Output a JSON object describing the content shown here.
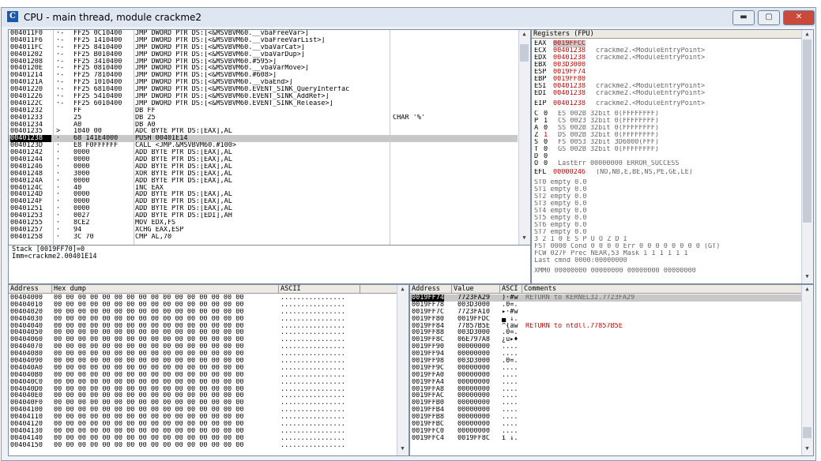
{
  "window": {
    "title": "CPU - main thread, module crackme2",
    "icon_letter": "C",
    "minimize": "▬",
    "maximize": "▢",
    "close": "✕"
  },
  "disasm": {
    "rows": [
      {
        "addr": "004011F0",
        "m": "·-",
        "hex": "FF25 0C10400",
        "asm": "JMP DWORD PTR DS:[<&MSVBVM60.__vbaFreeVar>]",
        "cmt": ""
      },
      {
        "addr": "004011F6",
        "m": "·-",
        "hex": "FF25 1410400",
        "asm": "JMP DWORD PTR DS:[<&MSVBVM60.__vbaFreeVarList>]",
        "cmt": ""
      },
      {
        "addr": "004011FC",
        "m": "·-",
        "hex": "FF25 8410400",
        "asm": "JMP DWORD PTR DS:[<&MSVBVM60.__vbaVarCat>]",
        "cmt": ""
      },
      {
        "addr": "00401202",
        "m": "·-",
        "hex": "FF25 B010400",
        "asm": "JMP DWORD PTR DS:[<&MSVBVM60.__vbaVarDup>]",
        "cmt": ""
      },
      {
        "addr": "00401208",
        "m": "·-",
        "hex": "FF25 3410400",
        "asm": "JMP DWORD PTR DS:[<&MSVBVM60.#595>]",
        "cmt": ""
      },
      {
        "addr": "0040120E",
        "m": "·-",
        "hex": "FF25 0810400",
        "asm": "JMP DWORD PTR DS:[<&MSVBVM60.__vbaVarMove>]",
        "cmt": ""
      },
      {
        "addr": "00401214",
        "m": "·-",
        "hex": "FF25 7810400",
        "asm": "JMP DWORD PTR DS:[<&MSVBVM60.#608>]",
        "cmt": ""
      },
      {
        "addr": "0040121A",
        "m": "·-",
        "hex": "FF25 1010400",
        "asm": "JMP DWORD PTR DS:[<&MSVBVM60.__vbaEnd>]",
        "cmt": ""
      },
      {
        "addr": "00401220",
        "m": "·-",
        "hex": "FF25 6810400",
        "asm": "JMP DWORD PTR DS:[<&MSVBVM60.EVENT_SINK_QueryInterfac",
        "cmt": ""
      },
      {
        "addr": "00401226",
        "m": "·-",
        "hex": "FF25 5410400",
        "asm": "JMP DWORD PTR DS:[<&MSVBVM60.EVENT_SINK_AddRef>]",
        "cmt": ""
      },
      {
        "addr": "0040122C",
        "m": "·-",
        "hex": "FF25 6010400",
        "asm": "JMP DWORD PTR DS:[<&MSVBVM60.EVENT_SINK_Release>]",
        "cmt": ""
      },
      {
        "addr": "00401232",
        "m": "",
        "hex": "FF",
        "asm": "DB FF",
        "cmt": ""
      },
      {
        "addr": "00401233",
        "m": "",
        "hex": "25",
        "asm": "DB 25",
        "cmt": "CHAR '%'"
      },
      {
        "addr": "00401234",
        "m": "",
        "hex": "A0",
        "asm": "DB A0",
        "cmt": ""
      },
      {
        "addr": "00401235",
        "m": ">",
        "hex": "1040 00",
        "asm": "ADC BYTE PTR DS:[EAX],AL",
        "cmt": ""
      },
      {
        "addr": "00401238",
        "m": "·",
        "hex": "68 141E4000",
        "asm": "PUSH 00401E14",
        "cmt": ""
      },
      {
        "addr": "0040123D",
        "m": "·",
        "hex": "E8 F0FFFFFF",
        "asm": "CALL <JMP.&MSVBVM60.#100>",
        "cmt": ""
      },
      {
        "addr": "00401242",
        "m": "·",
        "hex": "0000",
        "asm": "ADD BYTE PTR DS:[EAX],AL",
        "cmt": ""
      },
      {
        "addr": "00401244",
        "m": "·",
        "hex": "0000",
        "asm": "ADD BYTE PTR DS:[EAX],AL",
        "cmt": ""
      },
      {
        "addr": "00401246",
        "m": "·",
        "hex": "0000",
        "asm": "ADD BYTE PTR DS:[EAX],AL",
        "cmt": ""
      },
      {
        "addr": "00401248",
        "m": "·",
        "hex": "3000",
        "asm": "XOR BYTE PTR DS:[EAX],AL",
        "cmt": ""
      },
      {
        "addr": "0040124A",
        "m": "·",
        "hex": "0000",
        "asm": "ADD BYTE PTR DS:[EAX],AL",
        "cmt": ""
      },
      {
        "addr": "0040124C",
        "m": "·",
        "hex": "40",
        "asm": "INC EAX",
        "cmt": ""
      },
      {
        "addr": "0040124D",
        "m": "·",
        "hex": "0000",
        "asm": "ADD BYTE PTR DS:[EAX],AL",
        "cmt": ""
      },
      {
        "addr": "0040124F",
        "m": "·",
        "hex": "0000",
        "asm": "ADD BYTE PTR DS:[EAX],AL",
        "cmt": ""
      },
      {
        "addr": "00401251",
        "m": "·",
        "hex": "0000",
        "asm": "ADD BYTE PTR DS:[EAX],AL",
        "cmt": ""
      },
      {
        "addr": "00401253",
        "m": "·",
        "hex": "0027",
        "asm": "ADD BYTE PTR DS:[EDI],AH",
        "cmt": ""
      },
      {
        "addr": "00401255",
        "m": "·",
        "hex": "8CE2",
        "asm": "MOV EDX,FS",
        "cmt": ""
      },
      {
        "addr": "00401257",
        "m": "·",
        "hex": "94",
        "asm": "XCHG EAX,ESP",
        "cmt": ""
      },
      {
        "addr": "00401258",
        "m": "·",
        "hex": "3C 70",
        "asm": "CMP AL,70",
        "cmt": ""
      }
    ],
    "selected_index": 15
  },
  "info": {
    "line1": "Stack [0019FF70]=0",
    "line2": "Imm=crackme2.00401E14"
  },
  "registers": {
    "header": "Registers (FPU)",
    "gp": [
      {
        "name": "EAX",
        "val": "0019FFCC",
        "cmt": ""
      },
      {
        "name": "ECX",
        "val": "00401238",
        "cmt": "crackme2.<ModuleEntryPoint>"
      },
      {
        "name": "EDX",
        "val": "00401238",
        "cmt": "crackme2.<ModuleEntryPoint>"
      },
      {
        "name": "EBX",
        "val": "003D3000",
        "cmt": ""
      },
      {
        "name": "ESP",
        "val": "0019FF74",
        "cmt": ""
      },
      {
        "name": "EBP",
        "val": "0019FF80",
        "cmt": ""
      },
      {
        "name": "ESI",
        "val": "00401238",
        "cmt": "crackme2.<ModuleEntryPoint>"
      },
      {
        "name": "EDI",
        "val": "00401238",
        "cmt": "crackme2.<ModuleEntryPoint>"
      }
    ],
    "eip": {
      "name": "EIP",
      "val": "00401238",
      "cmt": "crackme2.<ModuleEntryPoint>"
    },
    "flags": [
      {
        "f": "C",
        "v": "0",
        "seg": "ES 002B 32bit 0(FFFFFFFF)"
      },
      {
        "f": "P",
        "v": "1",
        "seg": "CS 0023 32bit 0(FFFFFFFF)"
      },
      {
        "f": "A",
        "v": "0",
        "seg": "SS 002B 32bit 0(FFFFFFFF)"
      },
      {
        "f": "Z",
        "v": "1",
        "seg": "DS 002B 32bit 0(FFFFFFFF)"
      },
      {
        "f": "S",
        "v": "0",
        "seg": "FS 0053 32bit 3D6000(FFF)"
      },
      {
        "f": "T",
        "v": "0",
        "seg": "GS 002B 32bit 0(FFFFFFFF)"
      },
      {
        "f": "D",
        "v": "0",
        "seg": ""
      },
      {
        "f": "O",
        "v": "0",
        "seg": "LastErr 00000000 ERROR_SUCCESS"
      }
    ],
    "efl": {
      "label": "EFL",
      "val": "00000246",
      "cmt": "(NO,NB,E,BE,NS,PE,GE,LE)"
    },
    "st": [
      "ST0 empty 0.0",
      "ST1 empty 0.0",
      "ST2 empty 0.0",
      "ST3 empty 0.0",
      "ST4 empty 0.0",
      "ST5 empty 0.0",
      "ST6 empty 0.0",
      "ST7 empty 0.0"
    ],
    "fpu_bits": "               3 2 1 0      E S P U O Z D I",
    "fst": "FST 0000  Cond 0 0 0 0  Err 0 0 0 0 0 0 0 0  (GT)",
    "fcw": "FCW 027F  Prec NEAR,53  Mask    1 1 1 1 1 1",
    "last_cmnd": "Last cmnd 0000:00000000",
    "xmm0": "XMM0 00000000 00000000 00000000 00000000"
  },
  "dump": {
    "headers": {
      "address": "Address",
      "hex": "Hex dump",
      "ascii": "ASCII"
    },
    "hex_zero": "00 00 00 00 00 00 00 00 00 00 00 00 00 00 00 00",
    "ascii_zero": "................",
    "addresses": [
      "00404000",
      "00404010",
      "00404020",
      "00404030",
      "00404040",
      "00404050",
      "00404060",
      "00404070",
      "00404080",
      "00404090",
      "004040A0",
      "004040B0",
      "004040C0",
      "004040D0",
      "004040E0",
      "004040F0",
      "00404100",
      "00404110",
      "00404120",
      "00404130",
      "00404140",
      "00404150"
    ]
  },
  "stack": {
    "headers": {
      "address": "Address",
      "value": "Value",
      "ascii": "ASCI",
      "comments": "Comments"
    },
    "rows": [
      {
        "addr": "0019FF74",
        "val": "7723FA29",
        "asc": ")·#w",
        "cmt": "RETURN to KERNEL32.7723FA29",
        "sel": true
      },
      {
        "addr": "0019FF78",
        "val": "003D3000",
        "asc": ".0=.",
        "cmt": ""
      },
      {
        "addr": "0019FF7C",
        "val": "7723FA10",
        "asc": "▸·#w",
        "cmt": ""
      },
      {
        "addr": "0019FF80",
        "val": "0019FFDC",
        "asc": "▄ ↓.",
        "cmt": ""
      },
      {
        "addr": "0019FF84",
        "val": "77857B5E",
        "asc": "^{àw",
        "cmt": "RETURN to ntdll.77857B5E",
        "red": true
      },
      {
        "addr": "0019FF88",
        "val": "003D3000",
        "asc": ".0=.",
        "cmt": ""
      },
      {
        "addr": "0019FF8C",
        "val": "06E797A8",
        "asc": "¿ù▸♦",
        "cmt": ""
      },
      {
        "addr": "0019FF90",
        "val": "00000000",
        "asc": "....",
        "cmt": ""
      },
      {
        "addr": "0019FF94",
        "val": "00000000",
        "asc": "....",
        "cmt": ""
      },
      {
        "addr": "0019FF98",
        "val": "003D3000",
        "asc": ".0=.",
        "cmt": ""
      },
      {
        "addr": "0019FF9C",
        "val": "00000000",
        "asc": "....",
        "cmt": ""
      },
      {
        "addr": "0019FFA0",
        "val": "00000000",
        "asc": "....",
        "cmt": ""
      },
      {
        "addr": "0019FFA4",
        "val": "00000000",
        "asc": "....",
        "cmt": ""
      },
      {
        "addr": "0019FFA8",
        "val": "00000000",
        "asc": "....",
        "cmt": ""
      },
      {
        "addr": "0019FFAC",
        "val": "00000000",
        "asc": "....",
        "cmt": ""
      },
      {
        "addr": "0019FFB0",
        "val": "00000000",
        "asc": "....",
        "cmt": ""
      },
      {
        "addr": "0019FFB4",
        "val": "00000000",
        "asc": "....",
        "cmt": ""
      },
      {
        "addr": "0019FFB8",
        "val": "00000000",
        "asc": "....",
        "cmt": ""
      },
      {
        "addr": "0019FFBC",
        "val": "00000000",
        "asc": "....",
        "cmt": ""
      },
      {
        "addr": "0019FFC0",
        "val": "00000000",
        "asc": "....",
        "cmt": ""
      },
      {
        "addr": "0019FFC4",
        "val": "0019FF8C",
        "asc": "î ↓.",
        "cmt": ""
      }
    ]
  },
  "colors": {
    "reg_highlight": "#d40000",
    "selection": "#c8c8c8"
  }
}
